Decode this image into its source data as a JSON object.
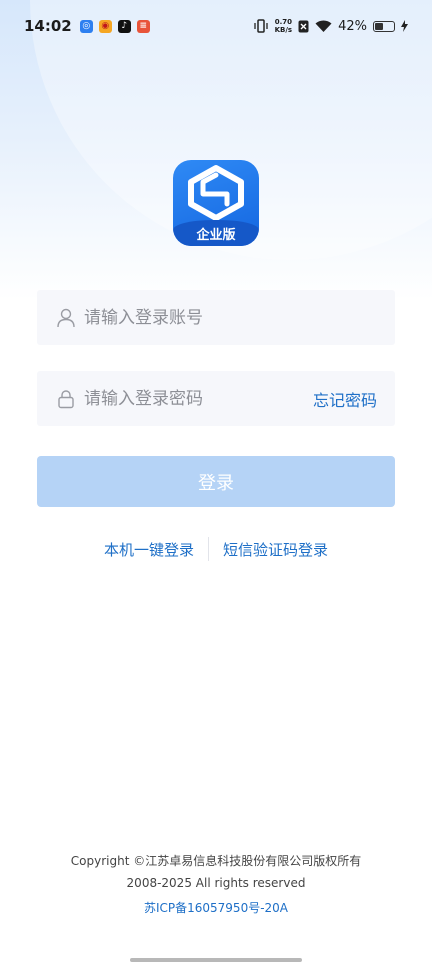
{
  "status_bar": {
    "time": "14:02",
    "net_speed_value": "0.70",
    "net_speed_unit": "KB/s",
    "battery": "42%",
    "icons": [
      "app-notification-icon",
      "weibo-icon",
      "tiktok-icon",
      "news-icon",
      "vibrate-icon",
      "sim-off-icon",
      "wifi-icon",
      "battery-icon",
      "charging-icon"
    ]
  },
  "logo": {
    "badge": "企业版",
    "colors": {
      "primary": "#1e78ee",
      "badge_bg": "#1558c8"
    }
  },
  "form": {
    "account_placeholder": "请输入登录账号",
    "password_placeholder": "请输入登录密码",
    "forgot_password": "忘记密码",
    "login_button": "登录"
  },
  "alt_login": {
    "one_click": "本机一键登录",
    "sms": "短信验证码登录"
  },
  "footer": {
    "copyright": "Copyright ©江苏卓易信息科技股份有限公司版权所有",
    "rights": "2008-2025 All rights reserved",
    "icp": "苏ICP备16057950号-20A"
  },
  "colors": {
    "accent": "#1e6fc7",
    "button_disabled": "#b5d3f6",
    "input_bg": "#f6f7fb"
  }
}
